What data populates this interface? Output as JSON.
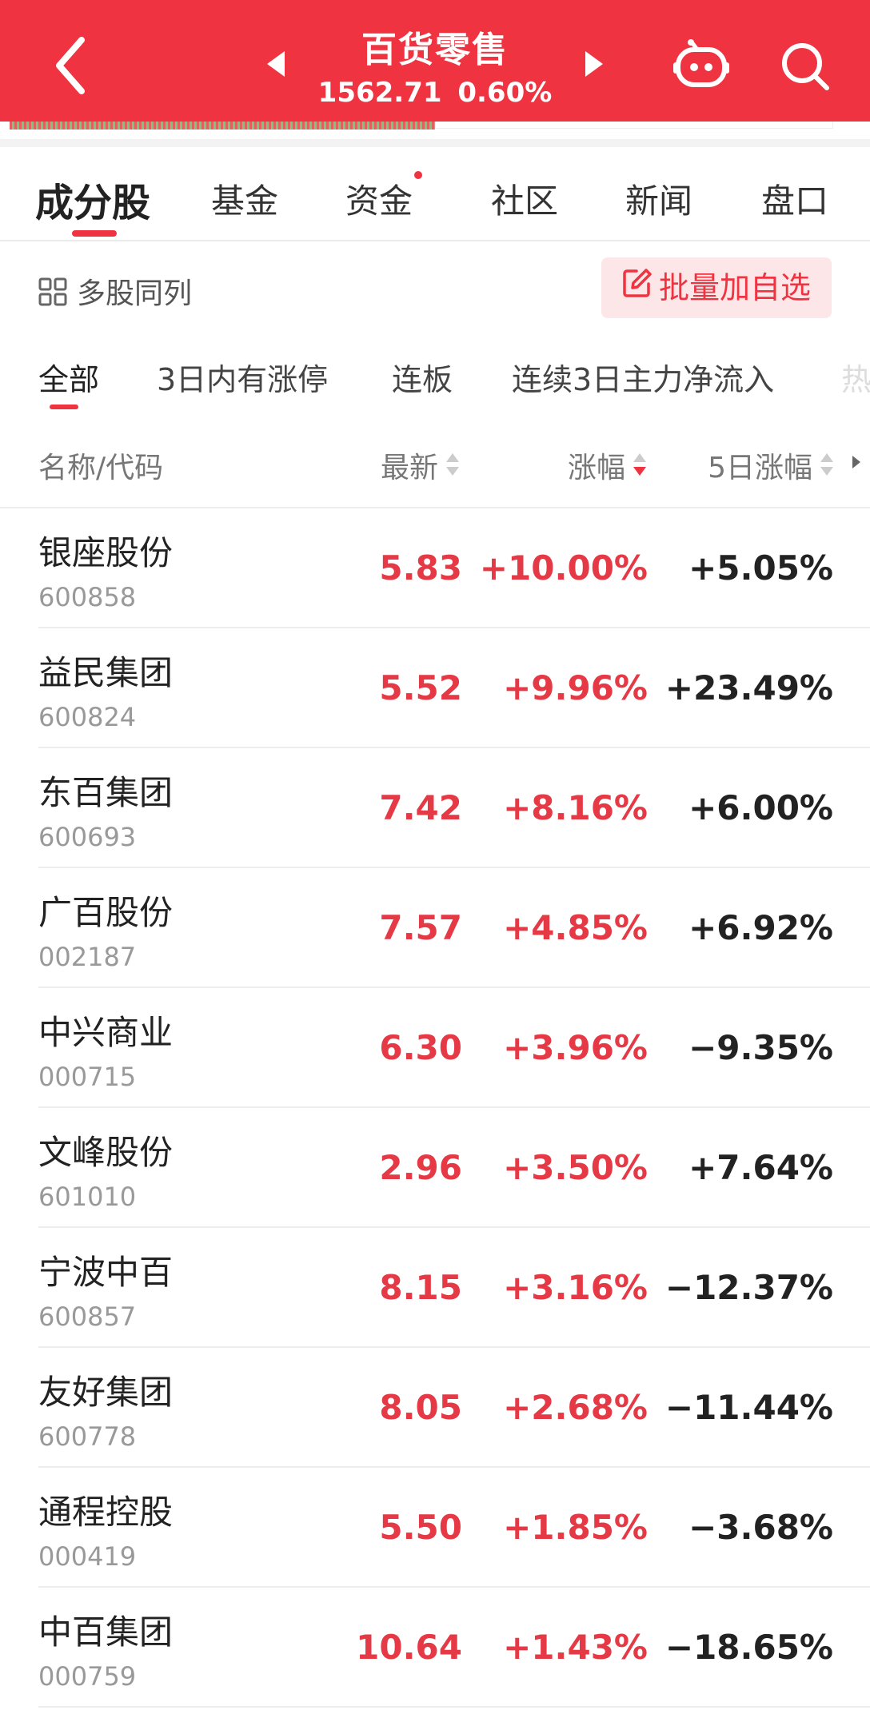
{
  "header": {
    "title": "百货零售",
    "index_value": "1562.71",
    "index_change": "0.60%"
  },
  "tabs": [
    {
      "label": "成分股"
    },
    {
      "label": "基金"
    },
    {
      "label": "资金"
    },
    {
      "label": "社区"
    },
    {
      "label": "新闻"
    },
    {
      "label": "盘口"
    }
  ],
  "toolbar": {
    "multi_label": "多股同列",
    "batch_label": "批量加自选"
  },
  "filters": [
    {
      "label": "全部"
    },
    {
      "label": "3日内有涨停"
    },
    {
      "label": "连板"
    },
    {
      "label": "连续3日主力净流入"
    },
    {
      "label": "热"
    }
  ],
  "columns": {
    "name": "名称/代码",
    "price": "最新",
    "change": "涨幅",
    "change5": "5日涨幅"
  },
  "colors": {
    "brand": "#ef3341",
    "up": "#e63946"
  },
  "stocks": [
    {
      "name": "银座股份",
      "code": "600858",
      "price": "5.83",
      "change": "+10.00%",
      "change5": "+5.05%"
    },
    {
      "name": "益民集团",
      "code": "600824",
      "price": "5.52",
      "change": "+9.96%",
      "change5": "+23.49%"
    },
    {
      "name": "东百集团",
      "code": "600693",
      "price": "7.42",
      "change": "+8.16%",
      "change5": "+6.00%"
    },
    {
      "name": "广百股份",
      "code": "002187",
      "price": "7.57",
      "change": "+4.85%",
      "change5": "+6.92%"
    },
    {
      "name": "中兴商业",
      "code": "000715",
      "price": "6.30",
      "change": "+3.96%",
      "change5": "−9.35%"
    },
    {
      "name": "文峰股份",
      "code": "601010",
      "price": "2.96",
      "change": "+3.50%",
      "change5": "+7.64%"
    },
    {
      "name": "宁波中百",
      "code": "600857",
      "price": "8.15",
      "change": "+3.16%",
      "change5": "−12.37%"
    },
    {
      "name": "友好集团",
      "code": "600778",
      "price": "8.05",
      "change": "+2.68%",
      "change5": "−11.44%"
    },
    {
      "name": "通程控股",
      "code": "000419",
      "price": "5.50",
      "change": "+1.85%",
      "change5": "−3.68%"
    },
    {
      "name": "中百集团",
      "code": "000759",
      "price": "10.64",
      "change": "+1.43%",
      "change5": "−18.65%"
    }
  ]
}
